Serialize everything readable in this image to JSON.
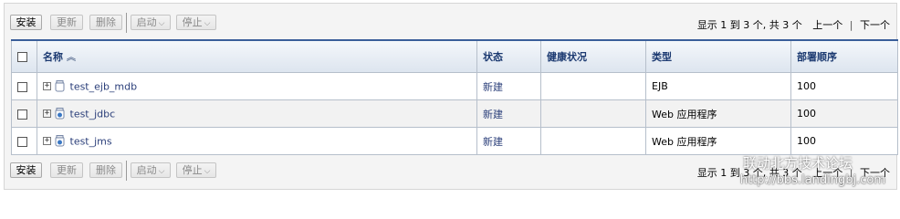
{
  "toolbar": {
    "install": "安装",
    "update": "更新",
    "delete": "删除",
    "start": "启动",
    "stop": "停止"
  },
  "pager": {
    "summary": "显示 1 到 3 个, 共 3 个",
    "prev": "上一个",
    "separator": "|",
    "next": "下一个"
  },
  "table": {
    "columns": [
      "名称",
      "状态",
      "健康状况",
      "类型",
      "部署顺序"
    ],
    "rows": [
      {
        "name": "test_ejb_mdb",
        "state": "新建",
        "health": "",
        "type": "EJB",
        "order": "100",
        "icon": "ejb-jar-icon"
      },
      {
        "name": "test_jdbc",
        "state": "新建",
        "health": "",
        "type": "Web 应用程序",
        "order": "100",
        "icon": "web-app-icon"
      },
      {
        "name": "test_jms",
        "state": "新建",
        "health": "",
        "type": "Web 应用程序",
        "order": "100",
        "icon": "web-app-icon"
      }
    ]
  },
  "watermark": {
    "logo": "联动北方技术论坛",
    "url": "http://bbs.landingbj.com"
  },
  "colors": {
    "header_text": "#1c3a71",
    "link": "#2b3f7a",
    "border": "#b6bfcb"
  }
}
